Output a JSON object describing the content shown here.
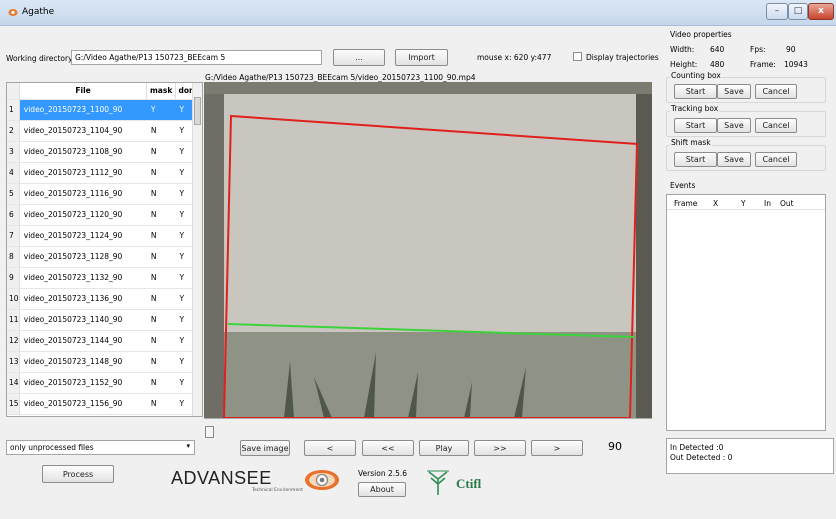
{
  "window": {
    "title": "Agathe",
    "min": "–",
    "max": "□",
    "close": "x"
  },
  "toolbar": {
    "working_dir_label": "Working directory",
    "working_dir_value": "G:/Video Agathe/P13 150723_BEEcam 5",
    "browse_label": "...",
    "import_label": "Import",
    "mouse_text": "mouse x: 620 y:477",
    "display_traj_label": "Display trajectories"
  },
  "video_path": "G:/Video Agathe/P13 150723_BEEcam 5/video_20150723_1100_90.mp4",
  "table": {
    "headers": [
      "File",
      "mask",
      "done"
    ],
    "rows": [
      {
        "num": "1",
        "file": "video_20150723_1100_90",
        "mask": "Y",
        "done": "Y"
      },
      {
        "num": "2",
        "file": "video_20150723_1104_90",
        "mask": "N",
        "done": "Y"
      },
      {
        "num": "3",
        "file": "video_20150723_1108_90",
        "mask": "N",
        "done": "Y"
      },
      {
        "num": "4",
        "file": "video_20150723_1112_90",
        "mask": "N",
        "done": "Y"
      },
      {
        "num": "5",
        "file": "video_20150723_1116_90",
        "mask": "N",
        "done": "Y"
      },
      {
        "num": "6",
        "file": "video_20150723_1120_90",
        "mask": "N",
        "done": "Y"
      },
      {
        "num": "7",
        "file": "video_20150723_1124_90",
        "mask": "N",
        "done": "Y"
      },
      {
        "num": "8",
        "file": "video_20150723_1128_90",
        "mask": "N",
        "done": "Y"
      },
      {
        "num": "9",
        "file": "video_20150723_1132_90",
        "mask": "N",
        "done": "Y"
      },
      {
        "num": "10",
        "file": "video_20150723_1136_90",
        "mask": "N",
        "done": "Y"
      },
      {
        "num": "11",
        "file": "video_20150723_1140_90",
        "mask": "N",
        "done": "Y"
      },
      {
        "num": "12",
        "file": "video_20150723_1144_90",
        "mask": "N",
        "done": "Y"
      },
      {
        "num": "13",
        "file": "video_20150723_1148_90",
        "mask": "N",
        "done": "Y"
      },
      {
        "num": "14",
        "file": "video_20150723_1152_90",
        "mask": "N",
        "done": "Y"
      },
      {
        "num": "15",
        "file": "video_20150723_1156_90",
        "mask": "N",
        "done": "Y"
      }
    ]
  },
  "filter": {
    "selected": "only unprocessed files"
  },
  "process_label": "Process",
  "playback": {
    "save_image": "Save image",
    "prev": "<",
    "rewind": "<<",
    "play": "Play",
    "forward": ">>",
    "next": ">",
    "frame": "90"
  },
  "brand": {
    "advansee": "ADVANSEE",
    "advansee_sub": "Technical Environment",
    "version": "Version 2.5.6",
    "about": "About",
    "ctifl": "Ctifl"
  },
  "props": {
    "title": "Video properties",
    "width_label": "Width:",
    "width_value": "640",
    "fps_label": "Fps:",
    "fps_value": "90",
    "height_label": "Height:",
    "height_value": "480",
    "frame_label": "Frame:",
    "frame_value": "10943"
  },
  "boxes": [
    {
      "title": "Counting box",
      "start": "Start",
      "save": "Save",
      "cancel": "Cancel"
    },
    {
      "title": "Tracking box",
      "start": "Start",
      "save": "Save",
      "cancel": "Cancel"
    },
    {
      "title": "Shift mask",
      "start": "Start",
      "save": "Save",
      "cancel": "Cancel"
    }
  ],
  "events": {
    "title": "Events",
    "cols": [
      "Frame",
      "X",
      "Y",
      "In",
      "Out"
    ],
    "in_detected": "In Detected :0",
    "out_detected": "Out Detected : 0"
  },
  "colors": {
    "selection": "#3399ff",
    "roi": "#e0201c",
    "counting_line": "#3cd23c"
  }
}
